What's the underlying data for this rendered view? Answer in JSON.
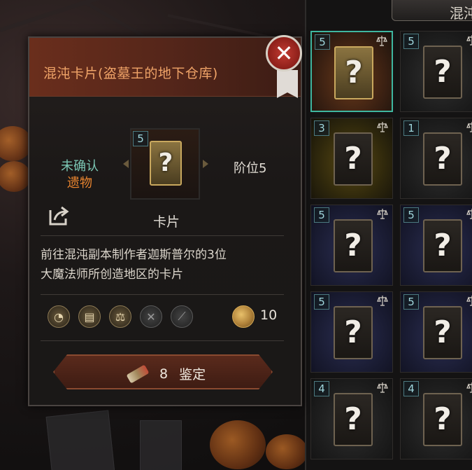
{
  "inventory": {
    "header_title": "混沌",
    "slots": [
      {
        "level": "5",
        "rarity": "legendary",
        "selected": true
      },
      {
        "level": "5",
        "rarity": "grey"
      },
      {
        "level": "3",
        "rarity": "unique"
      },
      {
        "level": "1",
        "rarity": "grey"
      },
      {
        "level": "5",
        "rarity": "rare"
      },
      {
        "level": "5",
        "rarity": "rare"
      },
      {
        "level": "5",
        "rarity": "rare"
      },
      {
        "level": "5",
        "rarity": "rare"
      },
      {
        "level": "4",
        "rarity": "grey"
      },
      {
        "level": "4",
        "rarity": "grey"
      }
    ]
  },
  "tooltip": {
    "title": "混沌卡片(盗墓王的地下仓库)",
    "close_icon": "close-icon",
    "status_unconfirmed": "未确认",
    "status_relic": "遗物",
    "item_level": "5",
    "rank": "阶位5",
    "item_type": "卡片",
    "description_line1": "前往混沌副本制作者迦斯普尔的3位",
    "description_line2": "大魔法师所创造地区的卡片",
    "property_icons": [
      "bag-icon",
      "chest-icon",
      "scale-icon",
      "disassemble-icon",
      "repair-icon"
    ],
    "price": "10",
    "identify_count": "8",
    "identify_label": "鉴定"
  },
  "colors": {
    "title": "#f0a468",
    "unconfirmed": "#7bc7b4",
    "relic": "#e8842f",
    "selected_border": "#3fb7a0"
  }
}
